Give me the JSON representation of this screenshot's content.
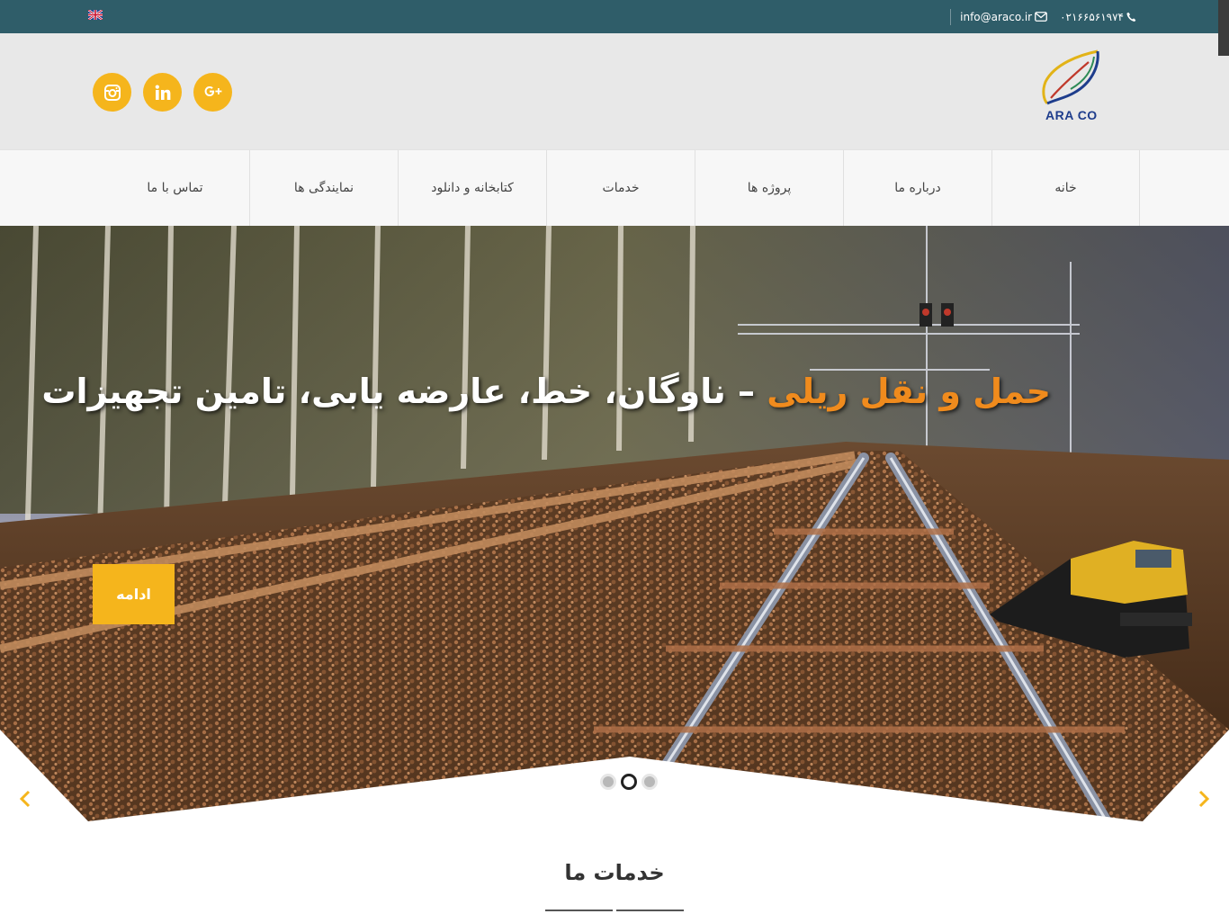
{
  "topbar": {
    "language_icon": "uk-flag-icon",
    "email": "info@araco.ir",
    "phone": "۰۲۱۶۶۵۶۱۹۷۴"
  },
  "header": {
    "logo_text": "ARA CO",
    "social": [
      "google-plus-icon",
      "linkedin-icon",
      "instagram-icon"
    ]
  },
  "nav": {
    "items": [
      "خانه",
      "درباره ما",
      "پروژه ها",
      "خدمات",
      "کتابخانه و دانلود",
      "نمایندگی ها",
      "تماس با ما"
    ]
  },
  "hero": {
    "headline_highlight": "حمل و نقل ریلی",
    "headline_rest": " – ناوگان، خط، عارضه یابی، تامین تجهیزات",
    "cta_label": "ادامه",
    "slides_count": 3,
    "active_slide": 2
  },
  "services": {
    "title": "خدمات ما"
  },
  "colors": {
    "topbar": "#2f5d69",
    "accent": "#f5b51c",
    "highlight": "#f08b1d",
    "header_bg": "#e8e8e8"
  }
}
